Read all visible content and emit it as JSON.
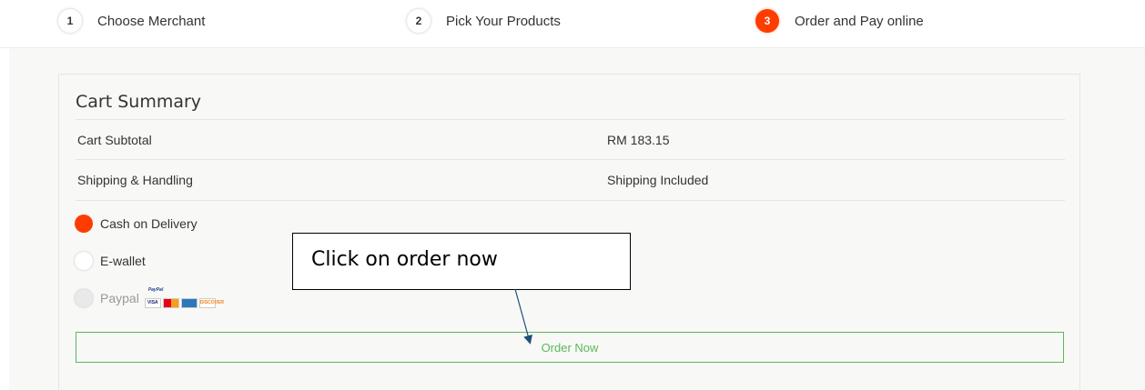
{
  "steps": [
    {
      "number": "1",
      "label": "Choose Merchant",
      "active": false
    },
    {
      "number": "2",
      "label": "Pick Your Products",
      "active": false
    },
    {
      "number": "3",
      "label": "Order and Pay online",
      "active": true
    }
  ],
  "cart": {
    "title": "Cart Summary",
    "rows": [
      {
        "label": "Cart Subtotal",
        "value": "RM 183.15"
      },
      {
        "label": "Shipping & Handling",
        "value": "Shipping Included"
      }
    ]
  },
  "payment_options": [
    {
      "label": "Cash on Delivery",
      "state": "checked"
    },
    {
      "label": "E-wallet",
      "state": "unchecked"
    },
    {
      "label": "Paypal",
      "state": "disabled",
      "logos": [
        "paypal-logo",
        "visa-logo",
        "mastercard-logo",
        "amex-logo",
        "discover-logo"
      ]
    }
  ],
  "card_logo_text": {
    "paypal": "PayPal",
    "visa": "VISA",
    "discover": "DISCOVER"
  },
  "order_button": {
    "label": "Order Now"
  },
  "annotation": {
    "text": "Click on order now"
  },
  "colors": {
    "accent": "#ff3c00",
    "button": "#5cb85c",
    "arrow": "#1f4e79"
  }
}
